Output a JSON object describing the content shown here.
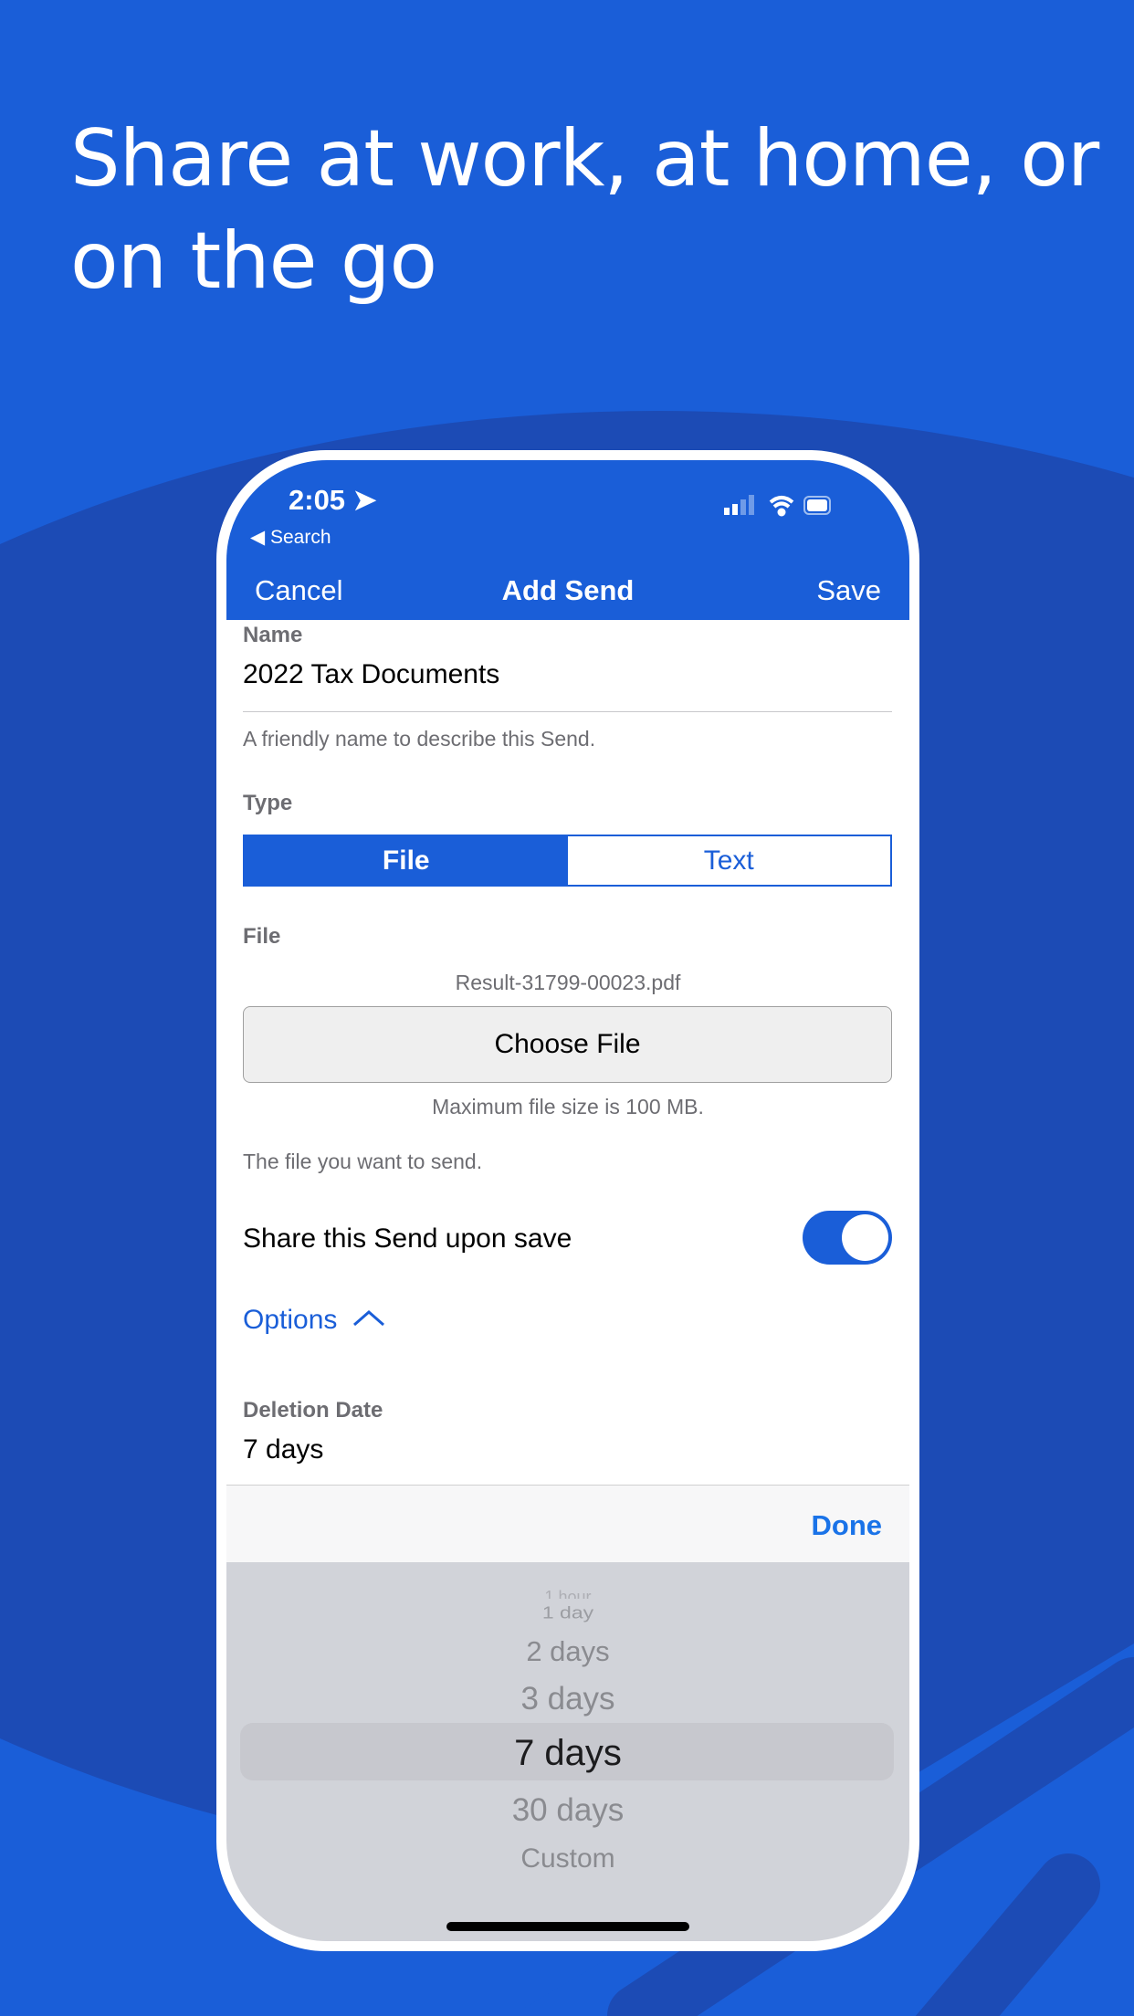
{
  "headline": "Share at work, at home, or on the go",
  "colors": {
    "brand": "#1a5ed8",
    "bg_dark": "#1c4bb5",
    "picker_bg": "#d1d3d9",
    "link": "#1a73e8"
  },
  "status_bar": {
    "time": "2:05",
    "back_label": "◀ Search"
  },
  "nav": {
    "cancel": "Cancel",
    "title": "Add Send",
    "save": "Save"
  },
  "form": {
    "name_label": "Name",
    "name_value": "2022 Tax Documents",
    "name_help": "A friendly name to describe this Send.",
    "type_label": "Type",
    "type_options": [
      "File",
      "Text"
    ],
    "type_selected": "File",
    "file_label": "File",
    "file_name": "Result-31799-00023.pdf",
    "choose_file": "Choose File",
    "max_size": "Maximum file size is 100 MB.",
    "file_help": "The file you want to send.",
    "share_label": "Share this Send upon save",
    "share_on": true,
    "options_label": "Options",
    "deletion_label": "Deletion Date",
    "deletion_value": "7 days"
  },
  "toolbar": {
    "done": "Done"
  },
  "picker": {
    "items": [
      "1 hour",
      "1 day",
      "2 days",
      "3 days",
      "7 days",
      "30 days",
      "Custom"
    ],
    "selected": "7 days"
  }
}
